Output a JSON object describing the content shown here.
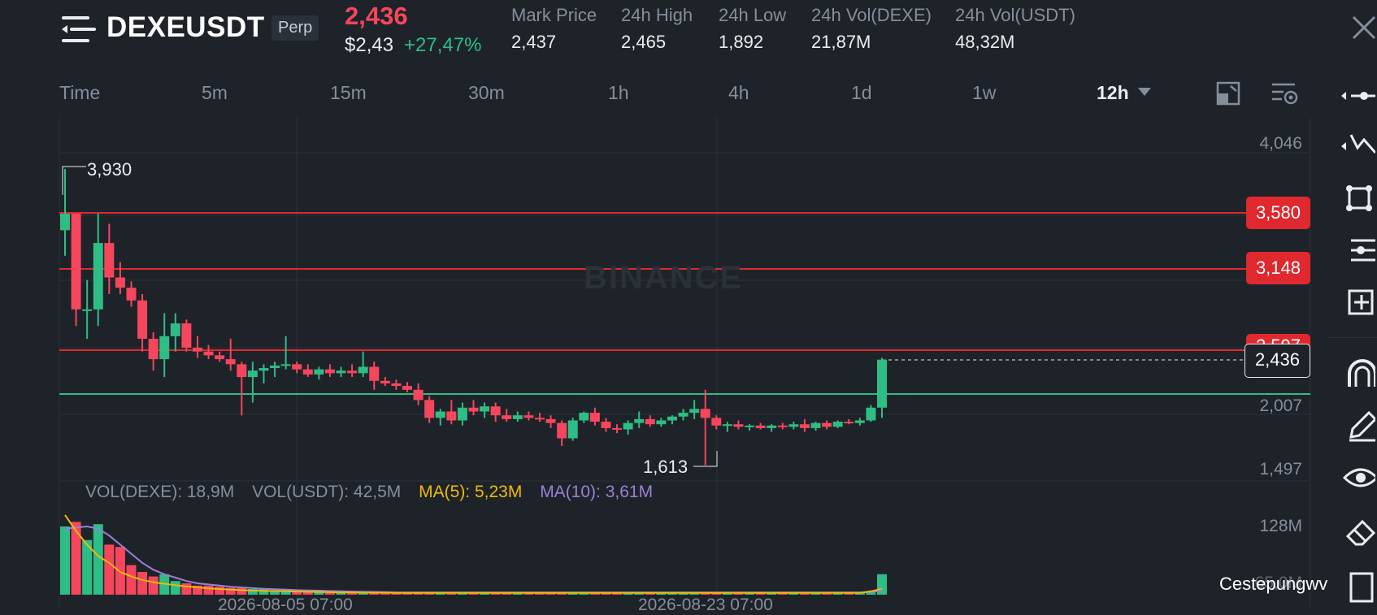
{
  "header": {
    "symbol": "DEXEUSDT",
    "contract_badge": "Perp",
    "last_price": "2,436",
    "usd_price": "$2,43",
    "change_pct": "+27,47%",
    "stats": [
      {
        "label": "Mark Price",
        "value": "2,437"
      },
      {
        "label": "24h High",
        "value": "2,465"
      },
      {
        "label": "24h Low",
        "value": "1,892"
      },
      {
        "label": "24h Vol(DEXE)",
        "value": "21,87M"
      },
      {
        "label": "24h Vol(USDT)",
        "value": "48,32M"
      }
    ]
  },
  "toolbar": {
    "timeframes": [
      "Time",
      "5m",
      "15m",
      "30m",
      "1h",
      "4h",
      "1d",
      "1w"
    ],
    "active_timeframe": "12h"
  },
  "chart": {
    "price_axis": [
      "4,046",
      "2,007",
      "1,497"
    ],
    "levels": [
      "3,580",
      "3,148",
      "2,597"
    ],
    "current_price_tag": "2,436",
    "high_marker": "3,930",
    "low_marker": "1,613",
    "watermark": "BINANCE",
    "volume": {
      "vol_base": "VOL(DEXE): 18,9M",
      "vol_quote": "VOL(USDT): 42,5M",
      "ma5": "MA(5): 5,23M",
      "ma10": "MA(10): 3,61M",
      "axis_top": "128M",
      "axis_mid": "65,0M"
    },
    "dates": [
      "2026-08-05 07:00",
      "2026-08-23 07:00"
    ]
  },
  "colors": {
    "up": "#2ebd85",
    "down": "#f6465d",
    "ma5": "#f0b90b",
    "ma10": "#9c7fd6",
    "level_red": "#e0282f",
    "level_green": "#2ebd85"
  },
  "credit": "Cestepungwv",
  "chart_data": {
    "type": "candlestick",
    "candles": [
      {
        "o": 3.45,
        "h": 3.93,
        "l": 3.25,
        "c": 3.58
      },
      {
        "o": 3.58,
        "h": 3.58,
        "l": 2.7,
        "c": 2.83
      },
      {
        "o": 2.83,
        "h": 3.06,
        "l": 2.6,
        "c": 2.83
      },
      {
        "o": 2.83,
        "h": 3.58,
        "l": 2.7,
        "c": 3.35
      },
      {
        "o": 3.35,
        "h": 3.5,
        "l": 2.95,
        "c": 3.08
      },
      {
        "o": 3.08,
        "h": 3.2,
        "l": 2.95,
        "c": 3.0
      },
      {
        "o": 3.0,
        "h": 3.05,
        "l": 2.85,
        "c": 2.9
      },
      {
        "o": 2.9,
        "h": 2.95,
        "l": 2.5,
        "c": 2.6
      },
      {
        "o": 2.6,
        "h": 2.65,
        "l": 2.35,
        "c": 2.44
      },
      {
        "o": 2.44,
        "h": 2.8,
        "l": 2.3,
        "c": 2.62
      },
      {
        "o": 2.62,
        "h": 2.8,
        "l": 2.5,
        "c": 2.72
      },
      {
        "o": 2.72,
        "h": 2.75,
        "l": 2.5,
        "c": 2.53
      },
      {
        "o": 2.53,
        "h": 2.62,
        "l": 2.45,
        "c": 2.5
      },
      {
        "o": 2.5,
        "h": 2.55,
        "l": 2.44,
        "c": 2.47
      },
      {
        "o": 2.47,
        "h": 2.5,
        "l": 2.42,
        "c": 2.44
      },
      {
        "o": 2.44,
        "h": 2.6,
        "l": 2.35,
        "c": 2.4
      },
      {
        "o": 2.4,
        "h": 2.42,
        "l": 2.0,
        "c": 2.3
      },
      {
        "o": 2.3,
        "h": 2.42,
        "l": 2.1,
        "c": 2.35
      },
      {
        "o": 2.35,
        "h": 2.4,
        "l": 2.25,
        "c": 2.37
      },
      {
        "o": 2.37,
        "h": 2.42,
        "l": 2.3,
        "c": 2.39
      },
      {
        "o": 2.39,
        "h": 2.62,
        "l": 2.36,
        "c": 2.4
      },
      {
        "o": 2.4,
        "h": 2.42,
        "l": 2.33,
        "c": 2.36
      },
      {
        "o": 2.36,
        "h": 2.4,
        "l": 2.3,
        "c": 2.32
      },
      {
        "o": 2.32,
        "h": 2.38,
        "l": 2.28,
        "c": 2.36
      },
      {
        "o": 2.36,
        "h": 2.4,
        "l": 2.3,
        "c": 2.33
      },
      {
        "o": 2.33,
        "h": 2.38,
        "l": 2.3,
        "c": 2.35
      },
      {
        "o": 2.35,
        "h": 2.4,
        "l": 2.3,
        "c": 2.33
      },
      {
        "o": 2.33,
        "h": 2.5,
        "l": 2.3,
        "c": 2.38
      },
      {
        "o": 2.38,
        "h": 2.42,
        "l": 2.2,
        "c": 2.27
      },
      {
        "o": 2.27,
        "h": 2.3,
        "l": 2.23,
        "c": 2.25
      },
      {
        "o": 2.25,
        "h": 2.28,
        "l": 2.2,
        "c": 2.23
      },
      {
        "o": 2.23,
        "h": 2.26,
        "l": 2.18,
        "c": 2.2
      },
      {
        "o": 2.2,
        "h": 2.25,
        "l": 2.08,
        "c": 2.12
      },
      {
        "o": 2.12,
        "h": 2.15,
        "l": 1.94,
        "c": 1.98
      },
      {
        "o": 1.98,
        "h": 2.05,
        "l": 1.92,
        "c": 2.03
      },
      {
        "o": 2.03,
        "h": 2.12,
        "l": 1.93,
        "c": 1.96
      },
      {
        "o": 1.96,
        "h": 2.1,
        "l": 1.92,
        "c": 2.06
      },
      {
        "o": 2.06,
        "h": 2.12,
        "l": 2.0,
        "c": 2.03
      },
      {
        "o": 2.03,
        "h": 2.1,
        "l": 1.98,
        "c": 2.07
      },
      {
        "o": 2.07,
        "h": 2.1,
        "l": 1.95,
        "c": 2.0
      },
      {
        "o": 2.0,
        "h": 2.05,
        "l": 1.95,
        "c": 1.97
      },
      {
        "o": 1.97,
        "h": 2.03,
        "l": 1.95,
        "c": 2.0
      },
      {
        "o": 2.0,
        "h": 2.03,
        "l": 1.96,
        "c": 1.98
      },
      {
        "o": 1.98,
        "h": 2.02,
        "l": 1.95,
        "c": 1.97
      },
      {
        "o": 1.97,
        "h": 2.0,
        "l": 1.9,
        "c": 1.94
      },
      {
        "o": 1.94,
        "h": 1.96,
        "l": 1.76,
        "c": 1.82
      },
      {
        "o": 1.82,
        "h": 1.98,
        "l": 1.8,
        "c": 1.96
      },
      {
        "o": 1.96,
        "h": 2.03,
        "l": 1.94,
        "c": 2.02
      },
      {
        "o": 2.02,
        "h": 2.06,
        "l": 1.92,
        "c": 1.95
      },
      {
        "o": 1.95,
        "h": 1.98,
        "l": 1.87,
        "c": 1.9
      },
      {
        "o": 1.9,
        "h": 1.93,
        "l": 1.86,
        "c": 1.89
      },
      {
        "o": 1.89,
        "h": 1.96,
        "l": 1.85,
        "c": 1.94
      },
      {
        "o": 1.94,
        "h": 2.03,
        "l": 1.9,
        "c": 1.97
      },
      {
        "o": 1.97,
        "h": 2.0,
        "l": 1.91,
        "c": 1.93
      },
      {
        "o": 1.93,
        "h": 1.98,
        "l": 1.91,
        "c": 1.96
      },
      {
        "o": 1.96,
        "h": 2.0,
        "l": 1.93,
        "c": 1.99
      },
      {
        "o": 1.99,
        "h": 2.05,
        "l": 1.96,
        "c": 2.02
      },
      {
        "o": 2.02,
        "h": 2.12,
        "l": 1.97,
        "c": 2.05
      },
      {
        "o": 2.05,
        "h": 2.2,
        "l": 1.61,
        "c": 1.98
      },
      {
        "o": 1.98,
        "h": 2.0,
        "l": 1.89,
        "c": 1.92
      },
      {
        "o": 1.92,
        "h": 1.95,
        "l": 1.87,
        "c": 1.93
      },
      {
        "o": 1.93,
        "h": 1.96,
        "l": 1.89,
        "c": 1.91
      },
      {
        "o": 1.91,
        "h": 1.93,
        "l": 1.88,
        "c": 1.92
      },
      {
        "o": 1.92,
        "h": 1.94,
        "l": 1.89,
        "c": 1.9
      },
      {
        "o": 1.9,
        "h": 1.93,
        "l": 1.87,
        "c": 1.92
      },
      {
        "o": 1.92,
        "h": 1.94,
        "l": 1.89,
        "c": 1.91
      },
      {
        "o": 1.91,
        "h": 1.95,
        "l": 1.89,
        "c": 1.93
      },
      {
        "o": 1.93,
        "h": 1.97,
        "l": 1.87,
        "c": 1.9
      },
      {
        "o": 1.9,
        "h": 1.95,
        "l": 1.88,
        "c": 1.94
      },
      {
        "o": 1.94,
        "h": 1.96,
        "l": 1.89,
        "c": 1.91
      },
      {
        "o": 1.91,
        "h": 1.96,
        "l": 1.9,
        "c": 1.95
      },
      {
        "o": 1.95,
        "h": 1.97,
        "l": 1.93,
        "c": 1.94
      },
      {
        "o": 1.94,
        "h": 1.98,
        "l": 1.92,
        "c": 1.96
      },
      {
        "o": 1.96,
        "h": 2.08,
        "l": 1.95,
        "c": 2.06
      },
      {
        "o": 2.06,
        "h": 2.45,
        "l": 1.98,
        "c": 2.436
      }
    ],
    "volumes": [
      30,
      32,
      24,
      31,
      22,
      21,
      13,
      10,
      8,
      9,
      6,
      5,
      4,
      4,
      3.5,
      3,
      3,
      2.5,
      2.5,
      2,
      2,
      2,
      1.6,
      1.6,
      1.4,
      1.4,
      1.3,
      1.3,
      1.2,
      1.1,
      1,
      1,
      1,
      1,
      1,
      0.9,
      0.9,
      0.9,
      0.9,
      0.8,
      0.8,
      0.8,
      0.8,
      0.8,
      0.8,
      0.8,
      0.8,
      0.8,
      0.8,
      0.8,
      0.8,
      0.8,
      0.8,
      0.8,
      0.8,
      0.8,
      0.8,
      0.8,
      1.2,
      0.8,
      0.8,
      0.8,
      0.8,
      0.8,
      0.8,
      0.8,
      0.8,
      0.8,
      0.8,
      0.8,
      0.8,
      0.8,
      0.8,
      1,
      9
    ],
    "ma5": [
      35,
      28,
      22,
      17,
      14,
      10,
      8,
      6.5,
      5.5,
      4.8,
      4.2,
      3.6,
      3.2,
      2.8,
      2.5,
      2.2,
      2,
      1.8,
      1.7,
      1.6,
      1.5,
      1.4,
      1.3,
      1.2,
      1.1,
      1,
      1,
      0.9,
      0.9,
      0.9,
      0.8,
      0.8,
      0.8,
      0.8,
      0.8,
      0.8,
      0.8,
      0.8,
      0.8,
      0.8,
      0.8,
      0.8,
      0.8,
      0.8,
      0.8,
      0.8,
      0.8,
      0.8,
      0.8,
      0.8,
      0.8,
      0.8,
      0.8,
      0.8,
      0.8,
      0.8,
      0.8,
      0.8,
      0.8,
      0.8,
      0.8,
      0.8,
      0.8,
      0.8,
      0.8,
      0.8,
      0.8,
      0.8,
      0.8,
      0.8,
      0.8,
      0.8,
      0.8,
      1.5,
      2.6
    ],
    "ma10": [
      29,
      29.5,
      30,
      29,
      26,
      22,
      18,
      14,
      11,
      9,
      7.5,
      6,
      5,
      4.5,
      4,
      3.5,
      3.2,
      2.9,
      2.6,
      2.4,
      2.2,
      2,
      1.9,
      1.8,
      1.6,
      1.5,
      1.4,
      1.3,
      1.2,
      1.1,
      1,
      1,
      1,
      1,
      1,
      1,
      1,
      1,
      1,
      1,
      1,
      1,
      1,
      1,
      1,
      1,
      1,
      1,
      1,
      1,
      1,
      1,
      1,
      1,
      1,
      1,
      1,
      1,
      1,
      1,
      1,
      1,
      1,
      1,
      1,
      1,
      1,
      1,
      1,
      1,
      1,
      1,
      1,
      1.2,
      1.8
    ],
    "levels": [
      3.58,
      3.148,
      2.597
    ],
    "support": 2.305,
    "ylim": [
      1.2,
      4.3
    ]
  }
}
